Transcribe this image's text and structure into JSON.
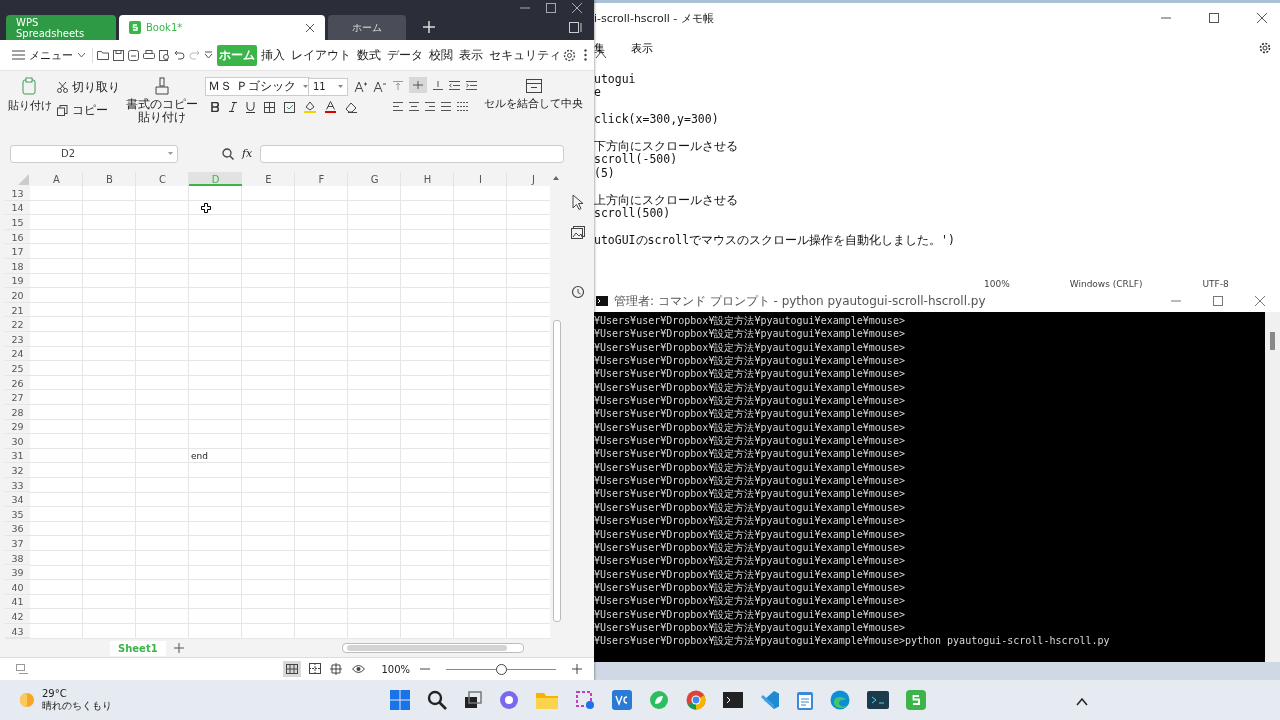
{
  "wps": {
    "tabs": [
      {
        "label": "WPS Spreadsheets",
        "kind": "brand",
        "selected": false
      },
      {
        "label": "Book1*",
        "kind": "doc",
        "selected": true
      },
      {
        "label": "ホーム",
        "kind": "plain",
        "selected": false
      }
    ],
    "menu": "メニュー",
    "ribbon_tabs": [
      {
        "label": "ホーム",
        "selected": true
      },
      {
        "label": "挿入",
        "selected": false
      },
      {
        "label": "レイアウト",
        "selected": false
      },
      {
        "label": "数式",
        "selected": false
      },
      {
        "label": "データ",
        "selected": false
      },
      {
        "label": "校閲",
        "selected": false
      },
      {
        "label": "表示",
        "selected": false
      },
      {
        "label": "セキュリティ",
        "selected": false
      }
    ],
    "paste": "貼り付け",
    "cut": "切り取り",
    "copy": "コピー",
    "format_painter": "書式のコピー貼り付け",
    "font_name": "ＭＳ Ｐゴシック",
    "font_size": "11",
    "merge": "セルを結合して中央",
    "name_box": "D2",
    "fx": "fx",
    "columns": [
      {
        "label": "A",
        "selected": false
      },
      {
        "label": "B",
        "selected": false
      },
      {
        "label": "C",
        "selected": false
      },
      {
        "label": "D",
        "selected": true
      },
      {
        "label": "E",
        "selected": false
      },
      {
        "label": "F",
        "selected": false
      },
      {
        "label": "G",
        "selected": false
      },
      {
        "label": "H",
        "selected": false
      },
      {
        "label": "I",
        "selected": false
      },
      {
        "label": "J",
        "selected": false
      }
    ],
    "rows": [
      {
        "label": "13"
      },
      {
        "label": "14"
      },
      {
        "label": "15"
      },
      {
        "label": "16"
      },
      {
        "label": "17"
      },
      {
        "label": "18"
      },
      {
        "label": "19"
      },
      {
        "label": "20"
      },
      {
        "label": "21"
      },
      {
        "label": "22"
      },
      {
        "label": "23"
      },
      {
        "label": "24"
      },
      {
        "label": "25"
      },
      {
        "label": "26"
      },
      {
        "label": "27"
      },
      {
        "label": "28"
      },
      {
        "label": "29"
      },
      {
        "label": "30"
      },
      {
        "label": "31",
        "column_d": "end"
      },
      {
        "label": "32"
      },
      {
        "label": "33"
      },
      {
        "label": "34"
      },
      {
        "label": "35"
      },
      {
        "label": "36"
      },
      {
        "label": "37"
      },
      {
        "label": "38"
      },
      {
        "label": "39"
      },
      {
        "label": "40"
      },
      {
        "label": "41"
      },
      {
        "label": "42"
      },
      {
        "label": "43"
      }
    ],
    "sheet_tabs": [
      {
        "label": "Sheet1",
        "selected": true
      }
    ],
    "zoom": "100%",
    "zoom_slider": {
      "level": 0.5
    }
  },
  "notepad": {
    "title": "i-scroll-hscroll - メモ帳",
    "menu": [
      "集",
      "表示"
    ],
    "paragraphs": [
      [
        "utogui",
        "e"
      ],
      [
        "click(x=300,y=300)"
      ],
      [
        "下方向にスクロールさせる",
        "scroll(-500)",
        "(5)"
      ],
      [
        "上方向にスクロールさせる",
        "scroll(500)"
      ],
      [
        "utoGUIのscrollでマウスのスクロール操作を自動化しました。')"
      ]
    ],
    "status": [
      "100%",
      "Windows (CRLF)",
      "UTF-8"
    ]
  },
  "cmd": {
    "title": "管理者: コマンド プロンプト - python  pyautogui-scroll-hscroll.py",
    "lines": [
      "¥Users¥user¥Dropbox¥設定方法¥pyautogui¥example¥mouse>",
      "¥Users¥user¥Dropbox¥設定方法¥pyautogui¥example¥mouse>",
      "¥Users¥user¥Dropbox¥設定方法¥pyautogui¥example¥mouse>",
      "¥Users¥user¥Dropbox¥設定方法¥pyautogui¥example¥mouse>",
      "¥Users¥user¥Dropbox¥設定方法¥pyautogui¥example¥mouse>",
      "¥Users¥user¥Dropbox¥設定方法¥pyautogui¥example¥mouse>",
      "¥Users¥user¥Dropbox¥設定方法¥pyautogui¥example¥mouse>",
      "¥Users¥user¥Dropbox¥設定方法¥pyautogui¥example¥mouse>",
      "¥Users¥user¥Dropbox¥設定方法¥pyautogui¥example¥mouse>",
      "¥Users¥user¥Dropbox¥設定方法¥pyautogui¥example¥mouse>",
      "¥Users¥user¥Dropbox¥設定方法¥pyautogui¥example¥mouse>",
      "¥Users¥user¥Dropbox¥設定方法¥pyautogui¥example¥mouse>",
      "¥Users¥user¥Dropbox¥設定方法¥pyautogui¥example¥mouse>",
      "¥Users¥user¥Dropbox¥設定方法¥pyautogui¥example¥mouse>",
      "¥Users¥user¥Dropbox¥設定方法¥pyautogui¥example¥mouse>",
      "¥Users¥user¥Dropbox¥設定方法¥pyautogui¥example¥mouse>",
      "¥Users¥user¥Dropbox¥設定方法¥pyautogui¥example¥mouse>",
      "¥Users¥user¥Dropbox¥設定方法¥pyautogui¥example¥mouse>",
      "¥Users¥user¥Dropbox¥設定方法¥pyautogui¥example¥mouse>",
      "¥Users¥user¥Dropbox¥設定方法¥pyautogui¥example¥mouse>",
      "¥Users¥user¥Dropbox¥設定方法¥pyautogui¥example¥mouse>",
      "¥Users¥user¥Dropbox¥設定方法¥pyautogui¥example¥mouse>",
      "¥Users¥user¥Dropbox¥設定方法¥pyautogui¥example¥mouse>",
      "¥Users¥user¥Dropbox¥設定方法¥pyautogui¥example¥mouse>",
      "¥Users¥user¥Dropbox¥設定方法¥pyautogui¥example¥mouse>python pyautogui-scroll-hscroll.py"
    ]
  },
  "taskbar": {
    "temperature": "29°C",
    "weather": "晴れのちくもり"
  }
}
